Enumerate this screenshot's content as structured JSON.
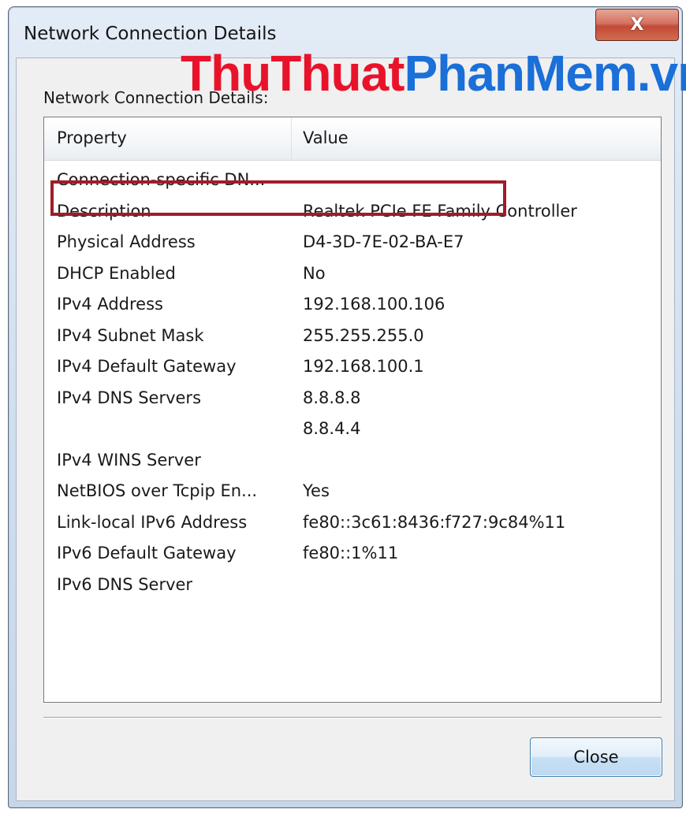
{
  "window": {
    "title": "Network Connection Details",
    "close_glyph": "X"
  },
  "watermark": {
    "part1": "ThuThuat",
    "part2": "PhanMem.vn"
  },
  "section_label": "Network Connection Details:",
  "table": {
    "columns": [
      "Property",
      "Value"
    ],
    "rows": [
      {
        "property": "Connection-specific DN...",
        "value": ""
      },
      {
        "property": "Description",
        "value": "Realtek PCIe FE Family Controller"
      },
      {
        "property": "Physical Address",
        "value": "D4-3D-7E-02-BA-E7"
      },
      {
        "property": "DHCP Enabled",
        "value": "No"
      },
      {
        "property": "IPv4 Address",
        "value": "192.168.100.106"
      },
      {
        "property": "IPv4 Subnet Mask",
        "value": "255.255.255.0"
      },
      {
        "property": "IPv4 Default Gateway",
        "value": "192.168.100.1"
      },
      {
        "property": "IPv4 DNS Servers",
        "value": "8.8.8.8"
      },
      {
        "property": "",
        "value": "8.8.4.4"
      },
      {
        "property": "IPv4 WINS Server",
        "value": ""
      },
      {
        "property": "NetBIOS over Tcpip En...",
        "value": "Yes"
      },
      {
        "property": "Link-local IPv6 Address",
        "value": "fe80::3c61:8436:f727:9c84%11"
      },
      {
        "property": "IPv6 Default Gateway",
        "value": "fe80::1%11"
      },
      {
        "property": "IPv6 DNS Server",
        "value": ""
      }
    ]
  },
  "buttons": {
    "close_label": "Close"
  },
  "colors": {
    "highlight_border": "#a01c28",
    "watermark_red": "#e8132b",
    "watermark_blue": "#1a6fd8"
  }
}
